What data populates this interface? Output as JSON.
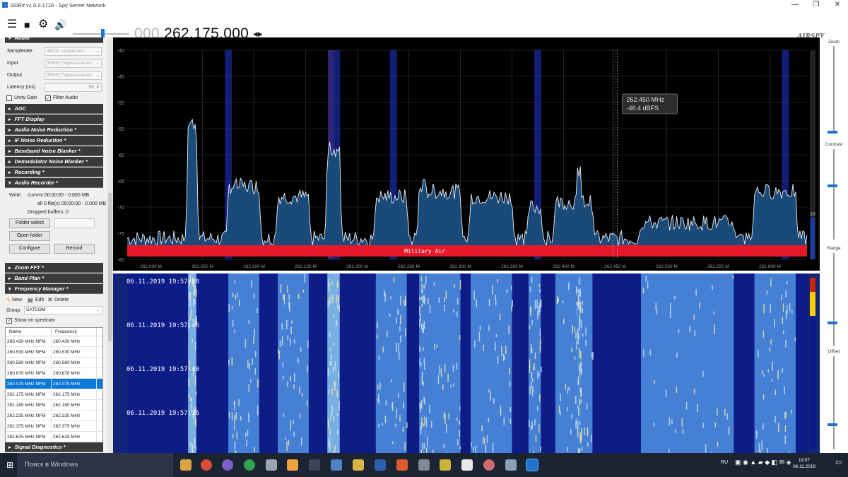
{
  "window": {
    "title": "SDR# v1.0.0.1716 - Spy Server Network",
    "minimize": "—",
    "maximize": "❐",
    "close": "✕"
  },
  "toolbar": {
    "menu_glyph": "☰",
    "stop_glyph": "■",
    "settings_glyph": "⚙",
    "audio_glyph": "🔊",
    "freq_dim": "000.",
    "freq_main": "262.175.000",
    "freq_arrows": "◂▸",
    "logo": "AIRSPY"
  },
  "audio": {
    "section_label": "Audio",
    "samplerate_label": "Samplerate",
    "samplerate_value": "48000 sample/sec",
    "input_label": "Input",
    "input_value": "[MME] Переназначен",
    "output_label": "Output",
    "output_value": "[MME] Переназначен",
    "latency_label": "Latency (ms)",
    "latency_value": "50",
    "unity_gain_label": "Unity Gain",
    "unity_gain_checked": false,
    "filter_audio_label": "Filter Audio",
    "filter_audio_checked": true
  },
  "sections": [
    "AGC",
    "FFT Display",
    "Audio Noise Reduction *",
    "IF Noise Reduction *",
    "Baseband Noise Blanker *",
    "Demodulator Noise Blanker *",
    "Recording *"
  ],
  "recorder": {
    "section_label": "Audio Recorder *",
    "write_label": "Write:",
    "current_line": "current 00:00:00 - 0.000 MB",
    "all_line": "all 0 file(s) 00:00:00 - 0.000 MB",
    "dropped_line": "Dropped buffers: 0",
    "folder_select": "Folder select",
    "open_folder": "Open folder",
    "configure": "Configure",
    "record": "Record"
  },
  "sections2": [
    "Zoom FFT *",
    "Band Plan *"
  ],
  "freq_manager": {
    "section_label": "Frequency Manager *",
    "new_label": "New",
    "edit_label": "Edit",
    "delete_label": "Delete",
    "group_label": "Group",
    "group_value": "SATCOM",
    "show_on_spectrum_label": "Show on spectrum",
    "show_on_spectrum_checked": true,
    "col_name": "Name",
    "col_frequency": "Frequency",
    "rows": [
      {
        "name": "260.430 MHz NFM",
        "freq": "260.430 MHz"
      },
      {
        "name": "260.530 MHz NFM",
        "freq": "260.530 MHz"
      },
      {
        "name": "260.580 MHz NFM",
        "freq": "260.580 MHz"
      },
      {
        "name": "260.670 MHz NFM",
        "freq": "260.670 MHz"
      },
      {
        "name": "262.075 MHz NFM",
        "freq": "262.075 MHz"
      },
      {
        "name": "262.175 MHz NFM",
        "freq": "262.175 MHz"
      },
      {
        "name": "262.180 MHz NFM",
        "freq": "262.180 MHz"
      },
      {
        "name": "262.235 MHz NFM",
        "freq": "262.235 MHz"
      },
      {
        "name": "262.375 MHz NFM",
        "freq": "262.375 MHz"
      },
      {
        "name": "262.615 MHz NFM",
        "freq": "262.615 MHz"
      }
    ],
    "selected_index": 4
  },
  "signal_diag": "Signal Diagnostics *",
  "spectrum": {
    "y_ticks": [
      "-40",
      "-45",
      "-50",
      "-55",
      "-60",
      "-65",
      "-70",
      "-75",
      "-80"
    ],
    "x_ticks": [
      "262.000 M",
      "262.050 M",
      "262.100 M",
      "262.150 M",
      "262.200 M",
      "262.250 M",
      "262.300 M",
      "262.350 M",
      "262.400 M",
      "262.450 M",
      "262.500 M",
      "262.550 M",
      "262.600 M"
    ],
    "x_range_mhz": [
      261.977,
      262.636
    ],
    "y_range_db": [
      -40,
      -80
    ],
    "tooltip_freq": "262.450 MHz",
    "tooltip_level": "-46.4 dBFS",
    "band_label": "Military Air",
    "scale_value": "20",
    "cursor_mhz": 262.45,
    "tuned_mhz": 262.175,
    "channel_markers_mhz": [
      262.075,
      262.175,
      262.18,
      262.235,
      262.375,
      262.615
    ],
    "noise_floor_db": -76,
    "signals": [
      {
        "center_mhz": 262.04,
        "half_width_mhz": 0.004,
        "level_db": -54
      },
      {
        "center_mhz": 262.09,
        "half_width_mhz": 0.015,
        "level_db": -66
      },
      {
        "center_mhz": 262.138,
        "half_width_mhz": 0.015,
        "level_db": -68
      },
      {
        "center_mhz": 262.177,
        "half_width_mhz": 0.006,
        "level_db": -59
      },
      {
        "center_mhz": 262.233,
        "half_width_mhz": 0.015,
        "level_db": -68
      },
      {
        "center_mhz": 262.263,
        "half_width_mhz": 0.003,
        "level_db": -66
      },
      {
        "center_mhz": 262.283,
        "half_width_mhz": 0.017,
        "level_db": -67
      },
      {
        "center_mhz": 262.33,
        "half_width_mhz": 0.02,
        "level_db": -68
      },
      {
        "center_mhz": 262.372,
        "half_width_mhz": 0.006,
        "level_db": -70
      },
      {
        "center_mhz": 262.41,
        "half_width_mhz": 0.018,
        "level_db": -69
      },
      {
        "center_mhz": 262.415,
        "half_width_mhz": 0.002,
        "level_db": -63
      },
      {
        "center_mhz": 262.52,
        "half_width_mhz": 0.045,
        "level_db": -73
      },
      {
        "center_mhz": 262.605,
        "half_width_mhz": 0.02,
        "level_db": -67
      }
    ]
  },
  "waterfall": {
    "timestamps": [
      "06.11.2019 19:57:48",
      "06.11.2019 19:57:46",
      "06.11.2019 19:57:40",
      "06.11.2019 19:57:36"
    ]
  },
  "rightpanel": {
    "zoom": "Zoom",
    "contrast": "Contrast",
    "range": "Range",
    "offset": "Offset"
  },
  "taskbar": {
    "search": "Поиск в Windows",
    "lang": "RU",
    "time": "19:57",
    "date": "06.11.2019"
  },
  "colors": {
    "accent": "#1e72d2",
    "band_red": "#e8182a",
    "selected_row": "#0a78d7",
    "spectrum_fill": "#1a4a78"
  }
}
